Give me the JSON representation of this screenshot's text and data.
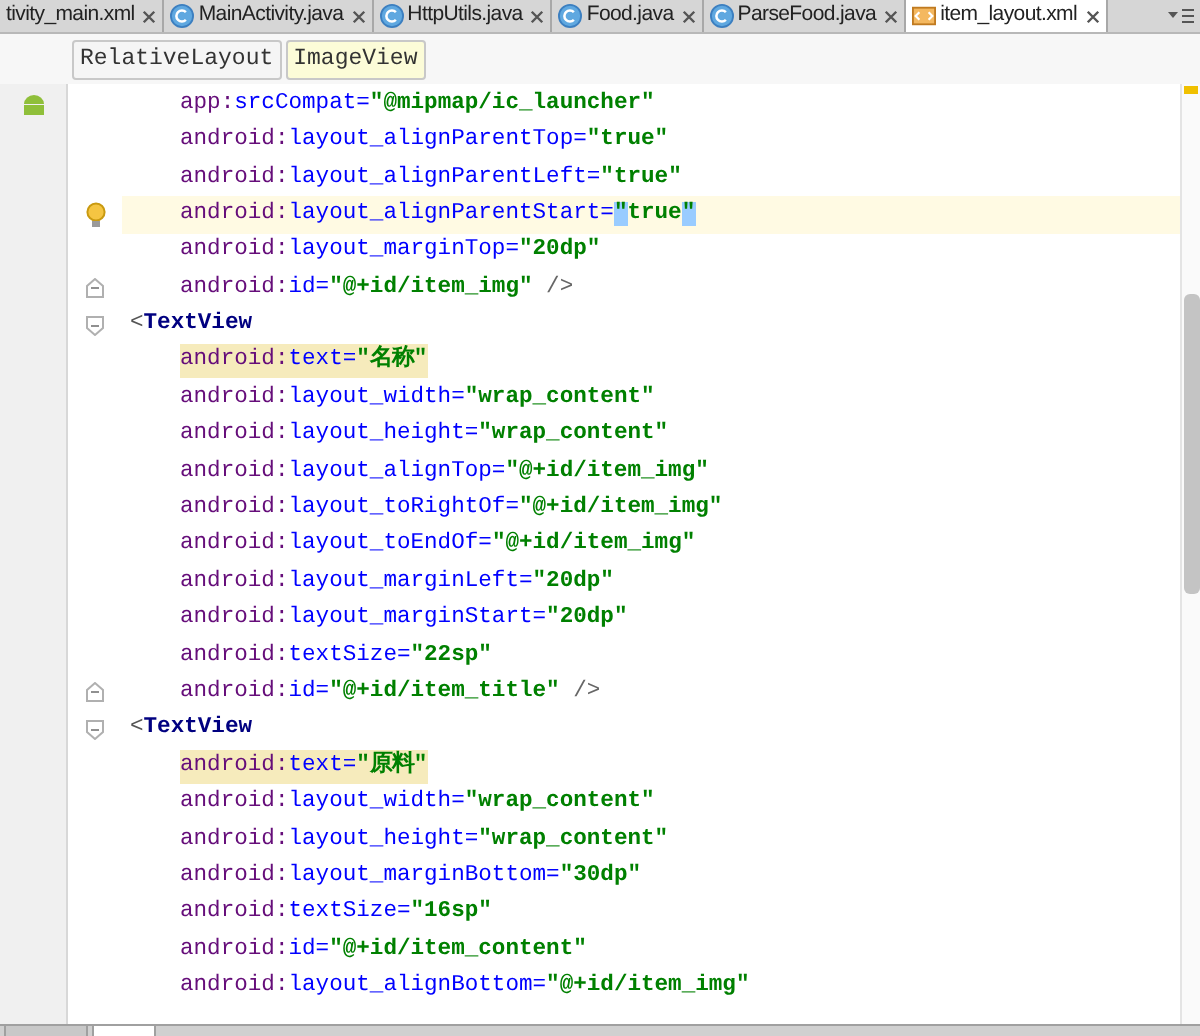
{
  "tabs": [
    {
      "label": "tivity_main.xml",
      "selected": false
    },
    {
      "label": "MainActivity.java",
      "kind": "class",
      "selected": false
    },
    {
      "label": "HttpUtils.java",
      "kind": "class",
      "selected": false
    },
    {
      "label": "Food.java",
      "kind": "class",
      "selected": false
    },
    {
      "label": "ParseFood.java",
      "kind": "class",
      "selected": false
    },
    {
      "label": "item_layout.xml",
      "kind": "xml",
      "selected": true
    }
  ],
  "breadcrumbs": [
    {
      "label": "RelativeLayout",
      "selected": false
    },
    {
      "label": "ImageView",
      "selected": true
    }
  ],
  "lines": [
    {
      "kind": "attribute",
      "prefix": "app:",
      "name": "srcCompat=",
      "value": "\"@mipmap/ic_launcher\"",
      "image_preview": true
    },
    {
      "kind": "attribute",
      "prefix": "android:",
      "name": "layout_alignParentTop=",
      "value": "\"true\""
    },
    {
      "kind": "attribute",
      "prefix": "android:",
      "name": "layout_alignParentLeft=",
      "value": "\"true\""
    },
    {
      "kind": "attribute",
      "prefix": "android:",
      "name": "layout_alignParentStart=",
      "value": "\"true\"",
      "current": true,
      "matched_quotes": true,
      "intention": true
    },
    {
      "kind": "attribute",
      "prefix": "android:",
      "name": "layout_marginTop=",
      "value": "\"20dp\""
    },
    {
      "kind": "attribute",
      "prefix": "android:",
      "name": "id=",
      "value": "\"@+id/item_img\"",
      "suffix": " />",
      "fold_end": true
    },
    {
      "kind": "tag",
      "bracket": "<",
      "tag": "TextView",
      "fold_start": true
    },
    {
      "kind": "attribute",
      "prefix": "android:",
      "name": "text=",
      "value": "\"名称\"",
      "highlighted": true
    },
    {
      "kind": "attribute",
      "prefix": "android:",
      "name": "layout_width=",
      "value": "\"wrap_content\""
    },
    {
      "kind": "attribute",
      "prefix": "android:",
      "name": "layout_height=",
      "value": "\"wrap_content\""
    },
    {
      "kind": "attribute",
      "prefix": "android:",
      "name": "layout_alignTop=",
      "value": "\"@+id/item_img\""
    },
    {
      "kind": "attribute",
      "prefix": "android:",
      "name": "layout_toRightOf=",
      "value": "\"@+id/item_img\""
    },
    {
      "kind": "attribute",
      "prefix": "android:",
      "name": "layout_toEndOf=",
      "value": "\"@+id/item_img\""
    },
    {
      "kind": "attribute",
      "prefix": "android:",
      "name": "layout_marginLeft=",
      "value": "\"20dp\""
    },
    {
      "kind": "attribute",
      "prefix": "android:",
      "name": "layout_marginStart=",
      "value": "\"20dp\""
    },
    {
      "kind": "attribute",
      "prefix": "android:",
      "name": "textSize=",
      "value": "\"22sp\""
    },
    {
      "kind": "attribute",
      "prefix": "android:",
      "name": "id=",
      "value": "\"@+id/item_title\"",
      "suffix": " />",
      "fold_end": true
    },
    {
      "kind": "tag",
      "bracket": "<",
      "tag": "TextView",
      "fold_start": true
    },
    {
      "kind": "attribute",
      "prefix": "android:",
      "name": "text=",
      "value": "\"原料\"",
      "highlighted": true
    },
    {
      "kind": "attribute",
      "prefix": "android:",
      "name": "layout_width=",
      "value": "\"wrap_content\""
    },
    {
      "kind": "attribute",
      "prefix": "android:",
      "name": "layout_height=",
      "value": "\"wrap_content\""
    },
    {
      "kind": "attribute",
      "prefix": "android:",
      "name": "layout_marginBottom=",
      "value": "\"30dp\""
    },
    {
      "kind": "attribute",
      "prefix": "android:",
      "name": "textSize=",
      "value": "\"16sp\""
    },
    {
      "kind": "attribute",
      "prefix": "android:",
      "name": "id=",
      "value": "\"@+id/item_content\""
    },
    {
      "kind": "attribute",
      "prefix": "android:",
      "name": "layout_alignBottom=",
      "value": "\"@+id/item_img\""
    }
  ]
}
